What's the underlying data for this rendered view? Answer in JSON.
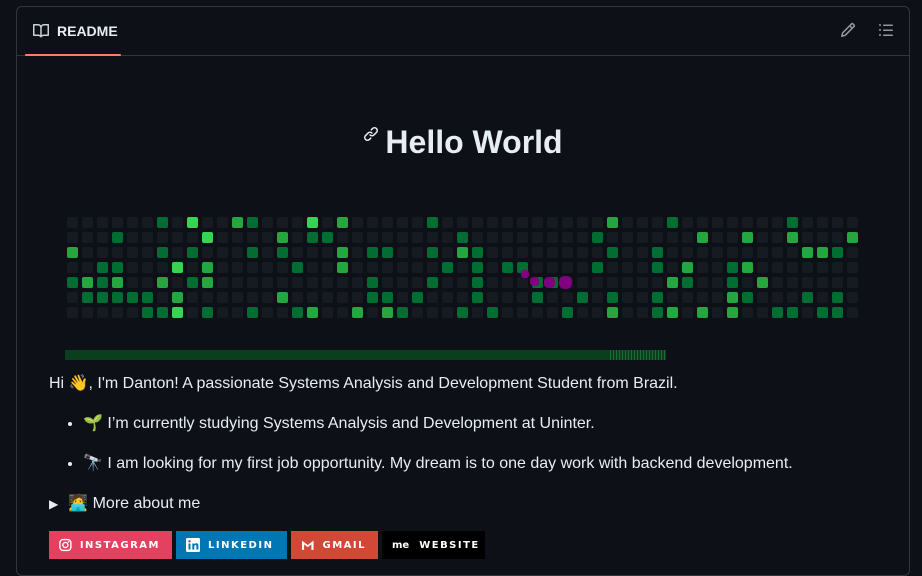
{
  "header": {
    "tab_label": "README",
    "edit_icon": "pencil-icon",
    "outline_icon": "list-unordered-icon"
  },
  "content": {
    "title": "Hello World",
    "intro": "Hi 👋, I'm Danton! A passionate Systems Analysis and Development Student from Brazil.",
    "bullets": [
      "🌱 I’m currently studying Systems Analysis and Development at Uninter.",
      "🔭 I am looking for my first job opportunity. My dream is to one day work with backend development."
    ],
    "details_summary": "🧑‍💻 More about me"
  },
  "contribution_graph": {
    "colors": {
      "empty": "#161b22",
      "l1": "#0e4429",
      "l2": "#006d32",
      "l3": "#26a641",
      "l4": "#39d353",
      "snake": "#800080"
    },
    "progress": 1.0
  },
  "badges": [
    {
      "label": "INSTAGRAM",
      "icon": "instagram-icon",
      "color": "#e4405f"
    },
    {
      "label": "LINKEDIN",
      "icon": "linkedin-icon",
      "color": "#0077b5"
    },
    {
      "label": "GMAIL",
      "icon": "gmail-icon",
      "color": "#d14836"
    },
    {
      "label": "WEBSITE",
      "icon": "me-icon",
      "icon_text": "me",
      "color": "#000000"
    }
  ]
}
